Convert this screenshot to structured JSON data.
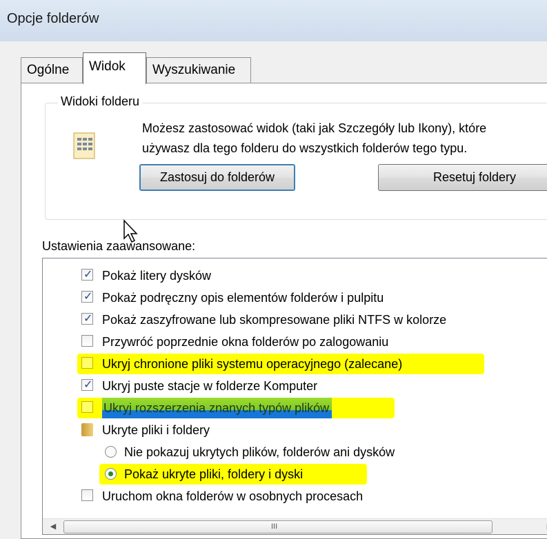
{
  "window": {
    "title": "Opcje folderów"
  },
  "tabs": [
    {
      "label": "Ogólne",
      "active": false
    },
    {
      "label": "Widok",
      "active": true
    },
    {
      "label": "Wyszukiwanie",
      "active": false
    }
  ],
  "folder_views": {
    "group_label": "Widoki folderu",
    "description_line1": "Możesz zastosować widok (taki jak Szczegóły lub Ikony), które",
    "description_line2": "używasz dla tego folderu do wszystkich folderów tego typu.",
    "apply_button": "Zastosuj do folderów",
    "reset_button": "Resetuj foldery"
  },
  "advanced": {
    "label": "Ustawienia zaawansowane:",
    "items": [
      {
        "type": "checkbox",
        "label": "Pokaż litery dysków",
        "checked": true
      },
      {
        "type": "checkbox",
        "label": "Pokaż podręczny opis elementów folderów i pulpitu",
        "checked": true
      },
      {
        "type": "checkbox",
        "label": "Pokaż zaszyfrowane lub skompresowane pliki NTFS w kolorze",
        "checked": true
      },
      {
        "type": "checkbox",
        "label": "Przywróć poprzednie okna folderów po zalogowaniu",
        "checked": false
      },
      {
        "type": "checkbox",
        "label": "Ukryj chronione pliki systemu operacyjnego (zalecane)",
        "checked": false,
        "highlight": "yellow"
      },
      {
        "type": "checkbox",
        "label": "Ukryj puste stacje w folderze Komputer",
        "checked": true
      },
      {
        "type": "checkbox",
        "label": "Ukryj rozszerzenia znanych typów plików",
        "checked": false,
        "highlight": "selected"
      },
      {
        "type": "folder",
        "label": "Ukryte pliki i foldery"
      },
      {
        "type": "radio",
        "label": "Nie pokazuj ukrytych plików, folderów ani dysków",
        "checked": false
      },
      {
        "type": "radio",
        "label": "Pokaż ukryte pliki, foldery i dyski",
        "checked": true,
        "highlight": "yellow"
      },
      {
        "type": "checkbox",
        "label": "Uruchom okna folderów w osobnych procesach",
        "checked": false
      }
    ],
    "scroll_grip": "III"
  },
  "colors": {
    "highlight_yellow": "#ffff00",
    "selection_blue": "#1777d8"
  }
}
